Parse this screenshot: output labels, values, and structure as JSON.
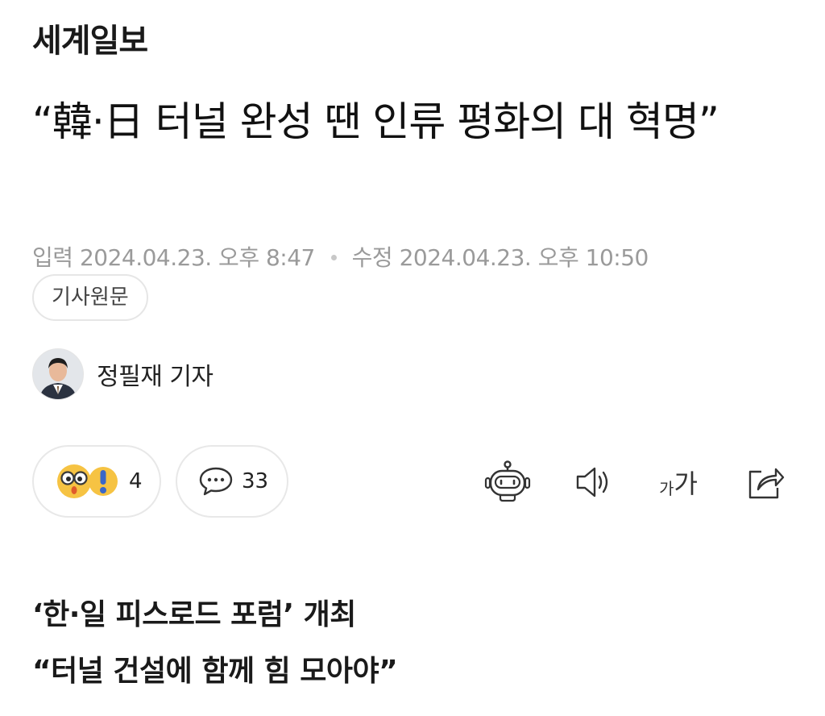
{
  "publisher": {
    "name": "세계일보"
  },
  "article": {
    "headline": "“韓·日 터널 완성 땐 인류 평화의 대 혁명”",
    "published_label": "입력",
    "published": "2024.04.23. 오후 8:47",
    "modified_label": "수정",
    "modified": "2024.04.23. 오후 10:50",
    "source_button": "기사원문",
    "author": "정필재 기자",
    "subheadings": [
      "‘한·일 피스로드 포럼’ 개최",
      "“터널 건설에 함께 힘 모아야”"
    ]
  },
  "engagement": {
    "reaction_count": "4",
    "comment_count": "33"
  },
  "toolbar": {
    "font_small": "가",
    "font_big": "가",
    "icons": [
      "robot-summary-icon",
      "speaker-icon",
      "font-size-icon",
      "share-icon"
    ]
  },
  "colors": {
    "text": "#111111",
    "muted": "#9a9a9a",
    "border": "#e8e8e8",
    "emoji_yellow": "#f6c343"
  }
}
